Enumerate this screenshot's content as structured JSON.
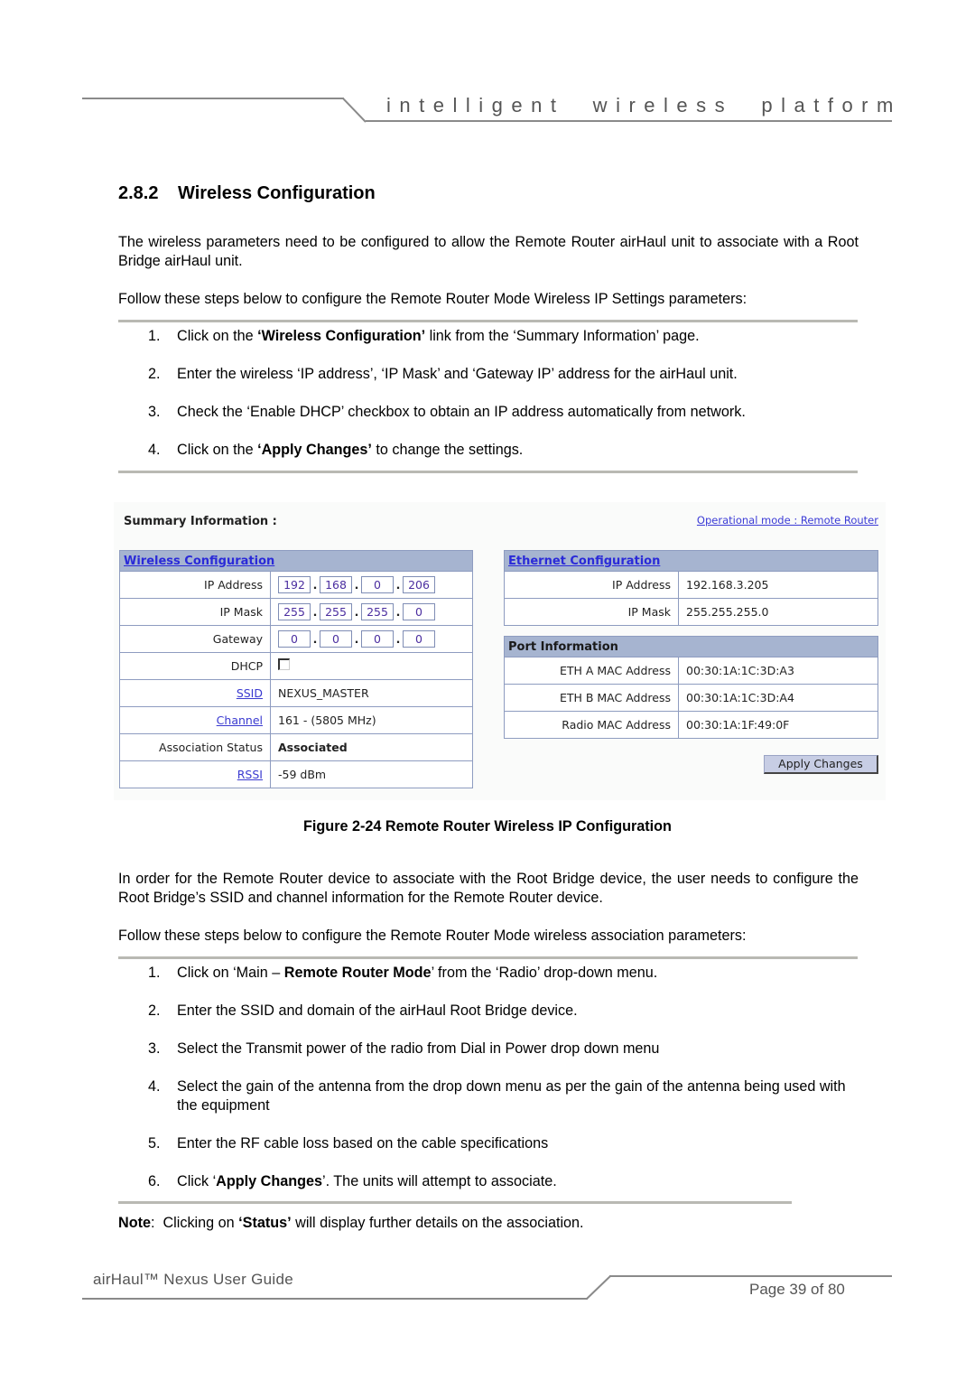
{
  "header": {
    "tagline": "intelligent  wireless  platform"
  },
  "section": {
    "number": "2.8.2",
    "title": "Wireless Configuration"
  },
  "intro_paragraph": "The wireless parameters need to be configured to allow the Remote Router airHaul unit to associate with a Root Bridge airHaul unit.",
  "steps_intro_1": "Follow these steps below to configure the Remote Router Mode Wireless IP Settings parameters:",
  "steps_1": [
    {
      "num": "1.",
      "pre": "Click on the ",
      "bold": "‘Wireless Configuration’",
      "post": " link from the ‘Summary Information’ page."
    },
    {
      "num": "2.",
      "pre": "Enter the wireless ‘IP address’, ‘IP Mask’ and ‘Gateway IP’ address for the airHaul unit.",
      "bold": "",
      "post": ""
    },
    {
      "num": "3.",
      "pre": "Check the ‘Enable DHCP’ checkbox to obtain an IP address automatically from network.",
      "bold": "",
      "post": ""
    },
    {
      "num": "4.",
      "pre": "Click on the ",
      "bold": "‘Apply Changes’",
      "post": " to change the settings."
    }
  ],
  "figure": {
    "summary_title": "Summary Information :",
    "operational_mode_link": "Operational mode : Remote Router",
    "wireless": {
      "header": "Wireless Configuration",
      "ip_address_label": "IP Address",
      "ip_address": [
        "192",
        "168",
        "0",
        "206"
      ],
      "ip_mask_label": "IP Mask",
      "ip_mask": [
        "255",
        "255",
        "255",
        "0"
      ],
      "gateway_label": "Gateway",
      "gateway": [
        "0",
        "0",
        "0",
        "0"
      ],
      "dhcp_label": "DHCP",
      "dhcp_checked": false,
      "ssid_label": "SSID",
      "ssid": "NEXUS_MASTER",
      "channel_label": "Channel",
      "channel": "161 - (5805 MHz)",
      "association_label": "Association Status",
      "association": "Associated",
      "rssi_label": "RSSI",
      "rssi": "-59 dBm"
    },
    "ethernet": {
      "header": "Ethernet Configuration",
      "ip_address_label": "IP Address",
      "ip_address": "192.168.3.205",
      "ip_mask_label": "IP Mask",
      "ip_mask": "255.255.255.0"
    },
    "port": {
      "header": "Port Information",
      "rows": [
        {
          "label": "ETH A MAC Address",
          "value": "00:30:1A:1C:3D:A3"
        },
        {
          "label": "ETH B MAC Address",
          "value": "00:30:1A:1C:3D:A4"
        },
        {
          "label": "Radio MAC Address",
          "value": "00:30:1A:1F:49:0F"
        }
      ]
    },
    "apply_button": "Apply Changes",
    "caption": "Figure 2-24 Remote Router Wireless IP Configuration"
  },
  "association_paragraph": "In order for the Remote Router device to associate with the Root Bridge device, the user needs to configure the Root Bridge’s SSID and channel information for the Remote Router device.",
  "steps_intro_2": "Follow these steps below to configure the Remote Router Mode wireless association parameters:",
  "steps_2": [
    {
      "num": "1.",
      "pre": "Click on ‘Main – ",
      "bold": "Remote Router Mode",
      "post": "’ from the ‘Radio’ drop-down menu."
    },
    {
      "num": "2.",
      "pre": "Enter the SSID and domain of the airHaul Root Bridge device.",
      "bold": "",
      "post": ""
    },
    {
      "num": "3.",
      "pre": "Select the Transmit power of the radio from Dial in Power drop down menu",
      "bold": "",
      "post": ""
    },
    {
      "num": "4.",
      "pre": "Select the gain of the antenna from the drop down menu as per the gain of the antenna being used with the equipment",
      "bold": "",
      "post": ""
    },
    {
      "num": "5.",
      "pre": "Enter the RF cable loss based on the cable specifications",
      "bold": "",
      "post": ""
    },
    {
      "num": "6.",
      "pre": "Click ‘",
      "bold": "Apply Changes",
      "post": "’. The units will attempt to associate."
    }
  ],
  "note": {
    "label": "Note",
    "pre": ":  Clicking on ",
    "bold": "‘Status’",
    "post": " will display further details on the association."
  },
  "footer": {
    "title": "airHaul™ Nexus User Guide",
    "page": "Page 39 of 80"
  }
}
